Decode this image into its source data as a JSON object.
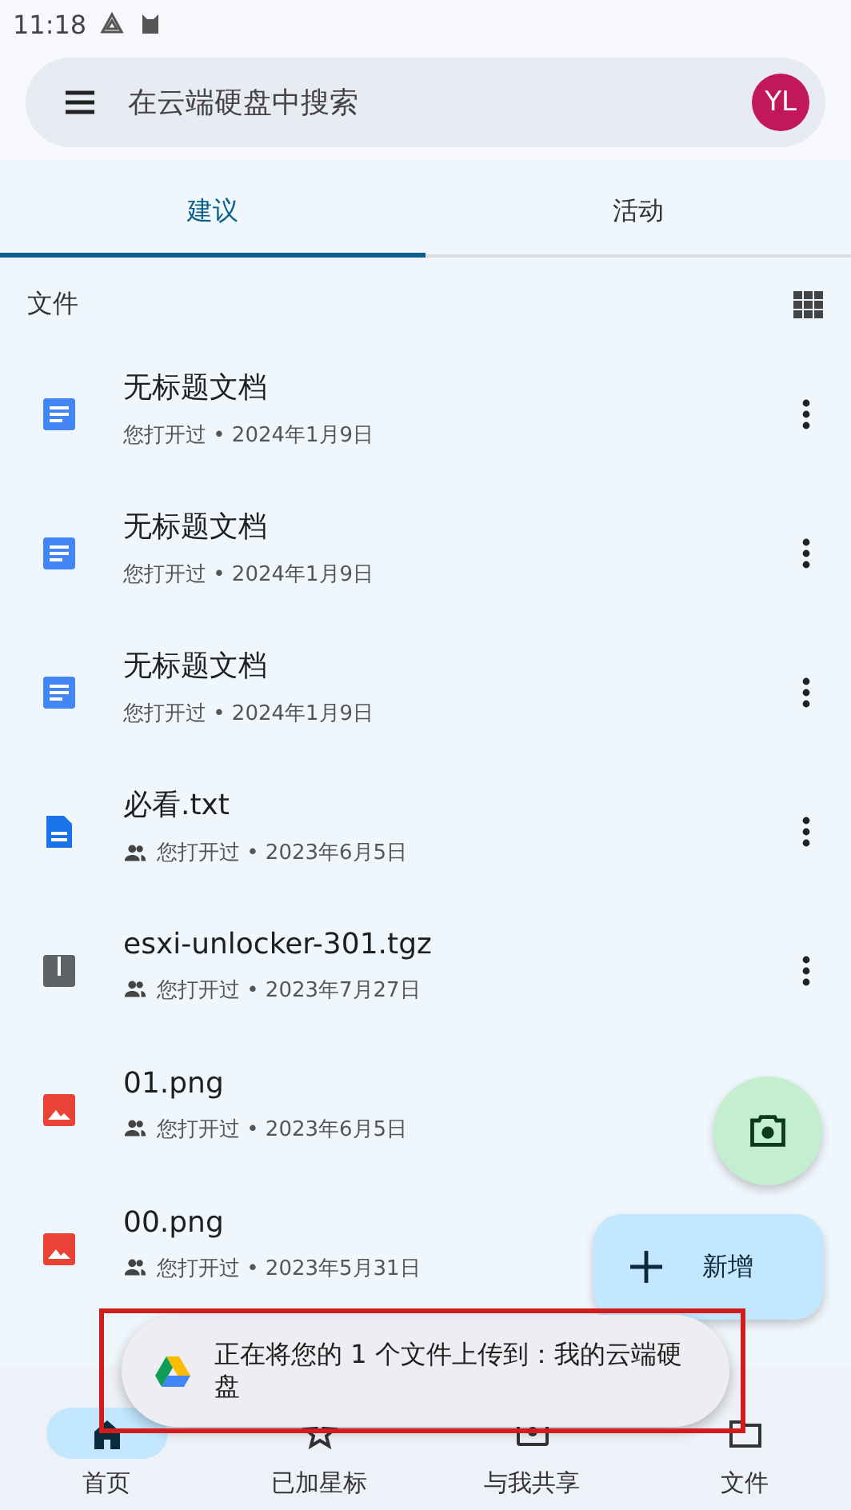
{
  "status_bar": {
    "time": "11:18"
  },
  "search": {
    "placeholder": "在云端硬盘中搜索",
    "avatar": "YL"
  },
  "tabs": [
    {
      "label": "建议",
      "selected": true
    },
    {
      "label": "活动",
      "selected": false
    }
  ],
  "section": {
    "title": "文件"
  },
  "files": [
    {
      "name": "无标题文档",
      "detail": "您打开过 • 2024年1月9日",
      "kind": "doc",
      "shared": false,
      "menu": true
    },
    {
      "name": "无标题文档",
      "detail": "您打开过 • 2024年1月9日",
      "kind": "doc",
      "shared": false,
      "menu": true
    },
    {
      "name": "无标题文档",
      "detail": "您打开过 • 2024年1月9日",
      "kind": "doc",
      "shared": false,
      "menu": true
    },
    {
      "name": "必看.txt",
      "detail": "您打开过 • 2023年6月5日",
      "kind": "text",
      "shared": true,
      "menu": true
    },
    {
      "name": "esxi-unlocker-301.tgz",
      "detail": "您打开过 • 2023年7月27日",
      "kind": "archive",
      "shared": true,
      "menu": true
    },
    {
      "name": "01.png",
      "detail": "您打开过 • 2023年6月5日",
      "kind": "image",
      "shared": true,
      "menu": false
    },
    {
      "name": "00.png",
      "detail": "您打开过 • 2023年5月31日",
      "kind": "image",
      "shared": true,
      "menu": false
    }
  ],
  "fab": {
    "label": "新增"
  },
  "toast": {
    "message": "正在将您的 1 个文件上传到：我的云端硬盘"
  },
  "nav": [
    {
      "label": "首页",
      "selected": true,
      "kind": "home"
    },
    {
      "label": "已加星标",
      "selected": false,
      "kind": "star"
    },
    {
      "label": "与我共享",
      "selected": false,
      "kind": "shared"
    },
    {
      "label": "文件",
      "selected": false,
      "kind": "folder"
    }
  ]
}
